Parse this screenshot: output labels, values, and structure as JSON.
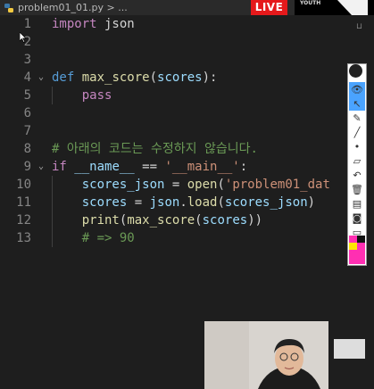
{
  "tab": {
    "title": "problem01_01.py > ..."
  },
  "live_badge": "LIVE",
  "channel_logo": "YOUTH",
  "editor": {
    "lines": [
      {
        "n": "1",
        "html": "<span class=\"kw\">import</span> json"
      },
      {
        "n": "2",
        "html": ""
      },
      {
        "n": "3",
        "html": ""
      },
      {
        "n": "4",
        "html": "<span class=\"def\">def</span> <span class=\"fn\">max_score</span>(<span class=\"par\">scores</span>):",
        "fold": true
      },
      {
        "n": "5",
        "html": "    <span class=\"kw\">pass</span>"
      },
      {
        "n": "6",
        "html": ""
      },
      {
        "n": "7",
        "html": ""
      },
      {
        "n": "8",
        "html": "<span class=\"cm\"># 아래의 코드는 수정하지 않습니다.</span>"
      },
      {
        "n": "9",
        "html": "<span class=\"kw\">if</span> <span class=\"par\">__name__</span> == <span class=\"str\">'__main__'</span>:",
        "fold": true
      },
      {
        "n": "10",
        "html": "    <span class=\"par\">scores_json</span> = <span class=\"fn\">open</span>(<span class=\"str\">'problem01_dat</span>"
      },
      {
        "n": "11",
        "html": "    <span class=\"par\">scores</span> = <span class=\"par\">json</span>.<span class=\"fn\">load</span>(<span class=\"par\">scores_json</span>)"
      },
      {
        "n": "12",
        "html": "    <span class=\"fn\">print</span>(<span class=\"fn\">max_score</span>(<span class=\"par\">scores</span>))"
      },
      {
        "n": "13",
        "html": "    <span class=\"cm\"># =&gt; 90</span>"
      }
    ]
  },
  "toolbar": {
    "items": [
      {
        "name": "eye-icon",
        "glyph": "👁",
        "selected": true
      },
      {
        "name": "pointer-icon",
        "glyph": "↖",
        "selected": true
      },
      {
        "name": "pen-icon",
        "glyph": "✎"
      },
      {
        "name": "line-icon",
        "glyph": "╱"
      },
      {
        "name": "dot-icon",
        "glyph": "•"
      },
      {
        "name": "eraser-icon",
        "glyph": "▱"
      },
      {
        "name": "undo-icon",
        "glyph": "↶"
      },
      {
        "name": "trash-icon",
        "glyph": "🗑"
      },
      {
        "name": "brush-icon",
        "glyph": "▤"
      },
      {
        "name": "camera-icon",
        "glyph": "◙"
      },
      {
        "name": "document-icon",
        "glyph": "▭"
      }
    ]
  },
  "colors": {
    "background": "#1e1e1e",
    "live": "#e5191b",
    "toolbar_selected": "#4aa3ff"
  }
}
